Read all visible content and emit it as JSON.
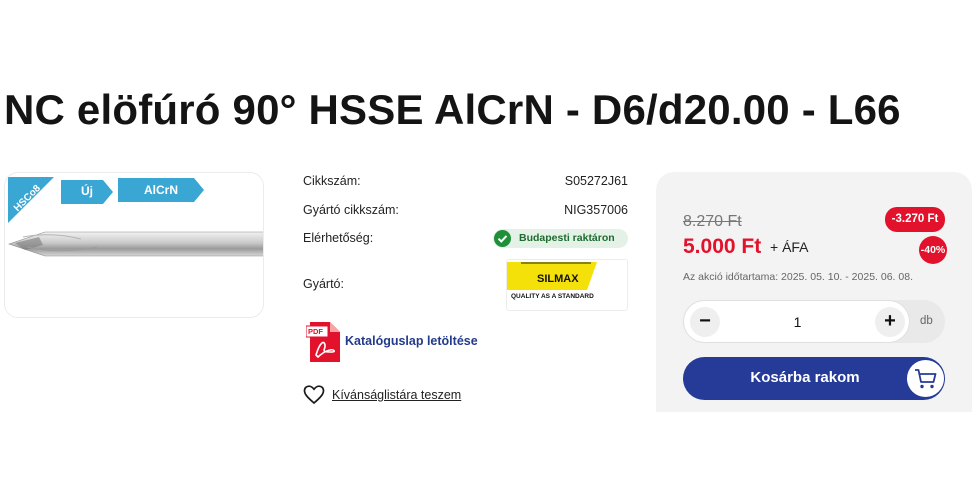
{
  "product": {
    "title": "NC elöfúró 90° HSSE AlCrN - D6/d20.00 - L66"
  },
  "badges": {
    "material": "HSCo8",
    "new": "Új",
    "coating": "AlCrN"
  },
  "specs": {
    "sku_label": "Cikkszám:",
    "sku_value": "S05272J61",
    "mfr_sku_label": "Gyártó cikkszám:",
    "mfr_sku_value": "NIG357006",
    "availability_label": "Elérhetőség:",
    "availability_value": "Budapesti raktáron",
    "manufacturer_label": "Gyártó:",
    "manufacturer_logo_text": "SILMAX",
    "manufacturer_logo_tagline": "QUALITY AS A STANDARD"
  },
  "links": {
    "pdf_icon_text": "PDF",
    "catalog": "Katalóguslap letöltése",
    "wishlist": "Kívánságlistára teszem"
  },
  "pricing": {
    "old_price": "8.270 Ft",
    "new_price": "5.000 Ft",
    "vat": "+ ÁFA",
    "discount_amount": "-3.270 Ft",
    "discount_percent": "-40%",
    "promo_period": "Az akció időtartama: 2025. 05. 10. - 2025. 06. 08."
  },
  "quantity": {
    "value": "1",
    "unit": "db",
    "minus": "−",
    "plus": "+"
  },
  "cart": {
    "label": "Kosárba rakom"
  },
  "colors": {
    "accent": "#263b98",
    "sale": "#e3122c",
    "badge_blue": "#3aa6d4",
    "stock_green": "#1f8f3a"
  },
  "icons": [
    "check-circle-icon",
    "pdf-icon",
    "heart-icon",
    "cart-icon",
    "minus-icon",
    "plus-icon"
  ]
}
